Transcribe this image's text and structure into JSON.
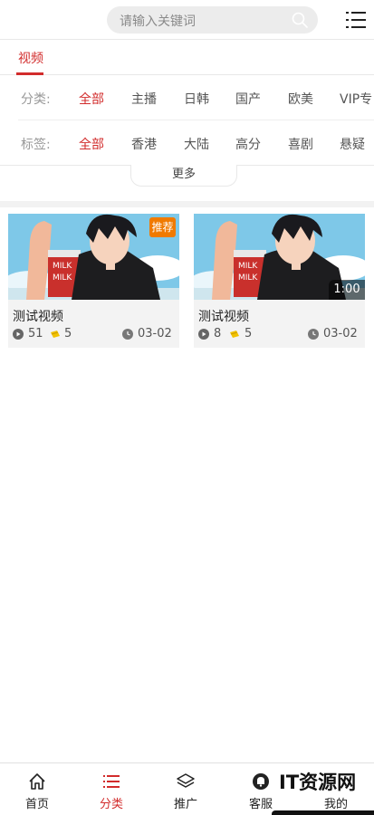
{
  "header": {
    "search_placeholder": "请输入关键词",
    "search_icon": "search-icon",
    "menu_icon": "menu-icon"
  },
  "tabs": [
    {
      "label": "视频",
      "active": true
    }
  ],
  "filters": {
    "category": {
      "label": "分类:",
      "options": [
        "全部",
        "主播",
        "日韩",
        "国产",
        "欧美",
        "VIP专"
      ],
      "selected": "全部"
    },
    "tag": {
      "label": "标签:",
      "options": [
        "全部",
        "香港",
        "大陆",
        "高分",
        "喜剧",
        "悬疑"
      ],
      "selected": "全部"
    },
    "more_label": "更多"
  },
  "videos": [
    {
      "title": "测试视频",
      "badge": "推荐",
      "duration": "",
      "plays": "51",
      "coins": "5",
      "date": "03-02"
    },
    {
      "title": "测试视频",
      "badge": "",
      "duration": "1:00",
      "plays": "8",
      "coins": "5",
      "date": "03-02"
    }
  ],
  "bottom_nav": [
    {
      "label": "首页",
      "icon": "home-icon",
      "active": false
    },
    {
      "label": "分类",
      "icon": "list-icon",
      "active": true
    },
    {
      "label": "推广",
      "icon": "layers-icon",
      "active": false
    },
    {
      "label": "客服",
      "icon": "bell-icon",
      "active": false
    },
    {
      "label": "我的",
      "icon": "user-icon",
      "active": false
    }
  ],
  "watermark": "IT资源网",
  "colors": {
    "accent": "#d22c2c",
    "badge": "#f07a00",
    "search_bg": "#ececec",
    "card_bg": "#f3f3f3"
  }
}
